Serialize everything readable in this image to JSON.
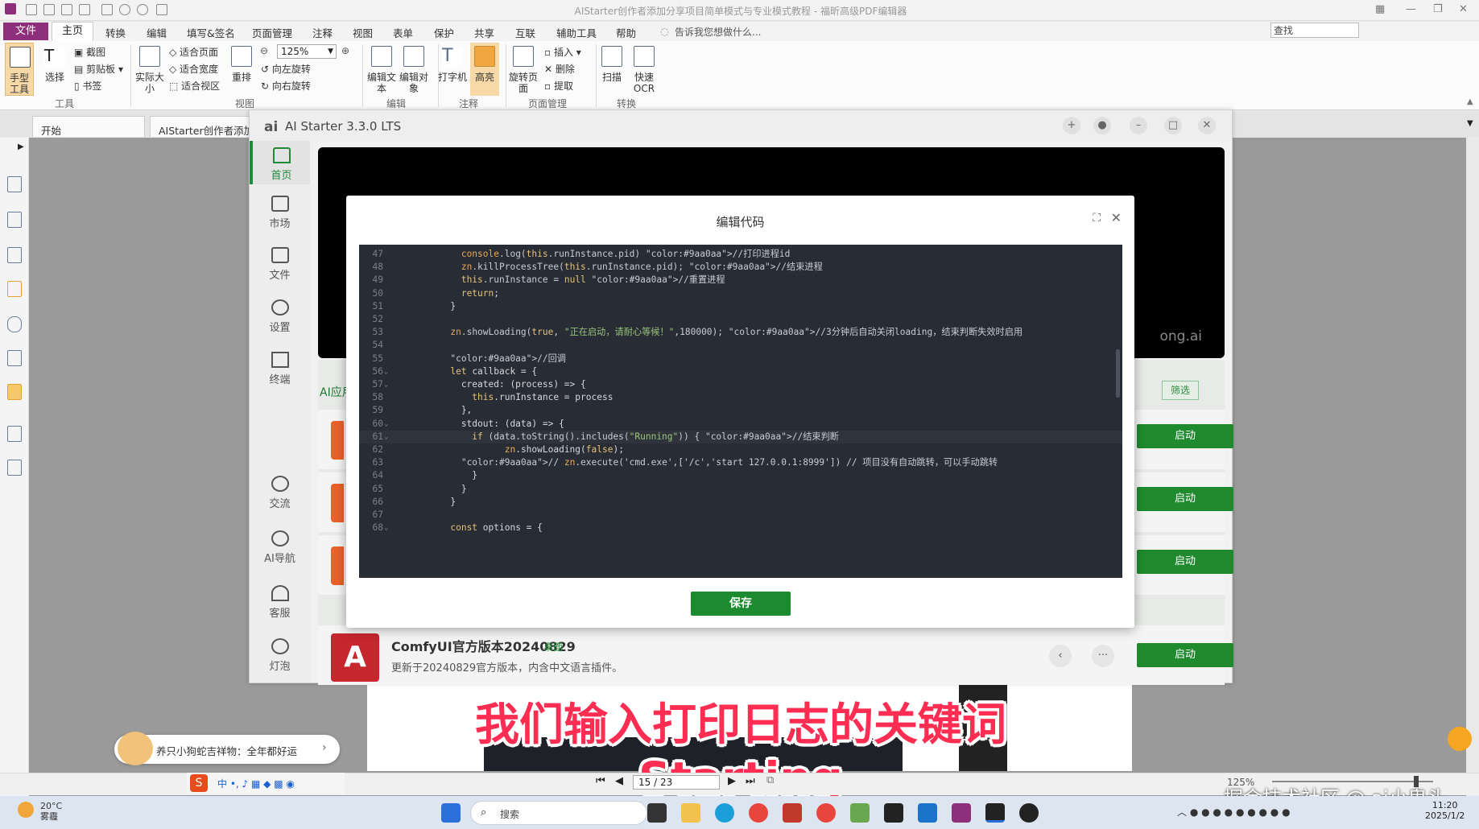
{
  "window": {
    "title": "AIStarter创作者添加分享项目简单模式与专业模式教程 - 福昕高级PDF编辑器"
  },
  "menu": {
    "items": [
      "文件",
      "主页",
      "转换",
      "编辑",
      "填写&签名",
      "页面管理",
      "注释",
      "视图",
      "表单",
      "保护",
      "共享",
      "互联",
      "辅助工具",
      "帮助"
    ],
    "tellme": "告诉我您想做什么...",
    "search_placeholder": "查找"
  },
  "ribbon": {
    "hand_tool": "手型工具",
    "select": "选择",
    "screenshot": "截图",
    "clipboard": "剪贴板",
    "bookmark": "书签",
    "actual_size": "实际大小",
    "fit_page": "适合页面",
    "fit_width": "适合宽度",
    "fit_visible": "适合视区",
    "reflow": "重排",
    "zoom_value": "125%",
    "rotate_left": "向左旋转",
    "rotate_right": "向右旋转",
    "edit_text": "编辑文本",
    "edit_object": "编辑对象",
    "typewriter": "打字机",
    "highlight": "高亮",
    "rotate_page": "旋转页面",
    "insert": "插入",
    "delete": "删除",
    "extract": "提取",
    "scan": "扫描",
    "quick_ocr": "快速OCR",
    "groups": [
      "工具",
      "视图",
      "编辑",
      "注释",
      "页面管理",
      "转换"
    ]
  },
  "tabs": {
    "start": "开始",
    "doc": "AIStarter创作者添加分"
  },
  "app": {
    "logo": "ai",
    "title": "AI Starter 3.3.0 LTS",
    "nav": [
      "首页",
      "市场",
      "文件",
      "设置",
      "终端",
      "交流",
      "AI导航",
      "客服",
      "灯泡"
    ],
    "banner_text": "ong.ai",
    "list_tab": "AI应用",
    "filter": "筛选",
    "start_label": "启动",
    "comfy": {
      "avatar": "A",
      "title": "ComfyUI官方版本20240829",
      "tag": "桌面",
      "desc": "更新于20240829官方版本，内含中文语言插件。"
    }
  },
  "dialog": {
    "title": "编辑代码",
    "save": "保存",
    "code_lines": [
      {
        "n": "47",
        "t": "            console.log(this.runInstance.pid) //打印进程id"
      },
      {
        "n": "48",
        "t": "            zn.killProcessTree(this.runInstance.pid); //结束进程"
      },
      {
        "n": "49",
        "t": "            this.runInstance = null //重置进程"
      },
      {
        "n": "50",
        "t": "            return;"
      },
      {
        "n": "51",
        "t": "          }"
      },
      {
        "n": "52",
        "t": ""
      },
      {
        "n": "53",
        "t": "          zn.showLoading(true, \"正在启动，请耐心等候！\",180000); //3分钟后自动关闭loading，结束判断失效时启用"
      },
      {
        "n": "54",
        "t": ""
      },
      {
        "n": "55",
        "t": "          //回调"
      },
      {
        "n": "56",
        "t": "          let callback = {"
      },
      {
        "n": "57",
        "t": "            created: (process) => {"
      },
      {
        "n": "58",
        "t": "              this.runInstance = process"
      },
      {
        "n": "59",
        "t": "            },"
      },
      {
        "n": "60",
        "t": "            stdout: (data) => {"
      },
      {
        "n": "61",
        "t": "              if (data.toString().includes(\"Running\")) { //结束判断"
      },
      {
        "n": "62",
        "t": "                    zn.showLoading(false);"
      },
      {
        "n": "63",
        "t": "            // zn.execute('cmd.exe',['/c','start 127.0.0.1:8999']) // 项目没有自动跳转，可以手动跳转"
      },
      {
        "n": "64",
        "t": "              }"
      },
      {
        "n": "65",
        "t": "            }"
      },
      {
        "n": "66",
        "t": "          }"
      },
      {
        "n": "67",
        "t": ""
      },
      {
        "n": "68",
        "t": "          const options = {"
      }
    ]
  },
  "subtitle": "我们输入打印日志的关键词Starting",
  "pager": {
    "page": "15 / 23",
    "zoom": "125%"
  },
  "mascot": {
    "text": "养只小狗蛇吉祥物：全年都好运"
  },
  "taskbar": {
    "temp": "20°C",
    "weather": "雾霾",
    "search": "搜索",
    "time": "11:20",
    "date": "2025/1/2"
  },
  "watermark": "掘金技术社区 @ ai小鬼头",
  "colors": {
    "accent_green": "#1f8a2e",
    "file_menu": "#8e2f7b",
    "subtitle": "#ff2d51",
    "editor_bg": "#282c34"
  }
}
